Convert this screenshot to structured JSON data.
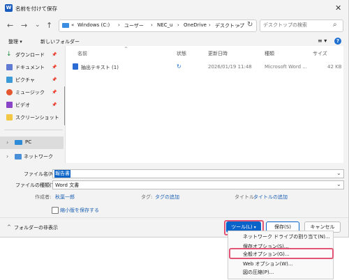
{
  "window": {
    "title": "名前を付けて保存",
    "close_glyph": "✕",
    "icon_letter": "W"
  },
  "nav": {
    "back": "←",
    "forward": "→",
    "up_dropdown": "⌄",
    "up": "↑",
    "refresh": "↻",
    "addr_chevron": "⌄"
  },
  "address": {
    "prefix": "«",
    "crumbs": [
      "Windows (C:)",
      "ユーザー",
      "NEC_u",
      "OneDrive",
      "デスクトップ"
    ],
    "sep": "›"
  },
  "search": {
    "placeholder": "デスクトップの検索",
    "icon": "⌕"
  },
  "toolbar": {
    "organize": "整理 ▾",
    "new_folder": "新しいフォルダー",
    "view": "≡ ▾",
    "help": "?"
  },
  "sidebar": {
    "items": [
      {
        "label": "ダウンロード",
        "pin": "📌"
      },
      {
        "label": "ドキュメント",
        "pin": "📌"
      },
      {
        "label": "ピクチャ",
        "pin": "📌"
      },
      {
        "label": "ミュージック",
        "pin": "📌"
      },
      {
        "label": "ビデオ",
        "pin": "📌"
      },
      {
        "label": "スクリーンショット",
        "pin": ""
      }
    ],
    "pc": "PC",
    "network": "ネットワーク",
    "expander": "›"
  },
  "columns": {
    "name": "名前",
    "status": "状態",
    "date": "更新日時",
    "type": "種類",
    "size": "サイズ"
  },
  "files": [
    {
      "name": "抽出テキスト (1)",
      "status": "↻",
      "date": "2026/01/19 11:48",
      "type": "Microsoft Word ...",
      "size": "42 KB"
    }
  ],
  "form": {
    "filename_label": "ファイル名(N):",
    "filename_value": "報告書",
    "filetype_label": "ファイルの種類(T):",
    "filetype_value": "Word 文書",
    "author_label": "作成者:",
    "author_value": "秋葉一郎",
    "tag_label": "タグ:",
    "tag_value": "タグの追加",
    "title_label": "タイトル:",
    "title_value": "タイトルの追加",
    "thumbnail_label": "縮小版を保存する"
  },
  "footer": {
    "hide_folders": "フォルダーの非表示",
    "tools": "ツール(L)",
    "save": "保存(S)",
    "cancel": "キャンセル"
  },
  "tools_menu": {
    "items": [
      "ネットワーク ドライブの割り当て(N)...",
      "保存オプション(S)...",
      "全般オプション(G)...",
      "Web オプション(W)...",
      "図の圧縮(P)..."
    ]
  },
  "colors": {
    "accent": "#0a63c9",
    "highlight": "#e25577",
    "link": "#1a5fb4"
  }
}
